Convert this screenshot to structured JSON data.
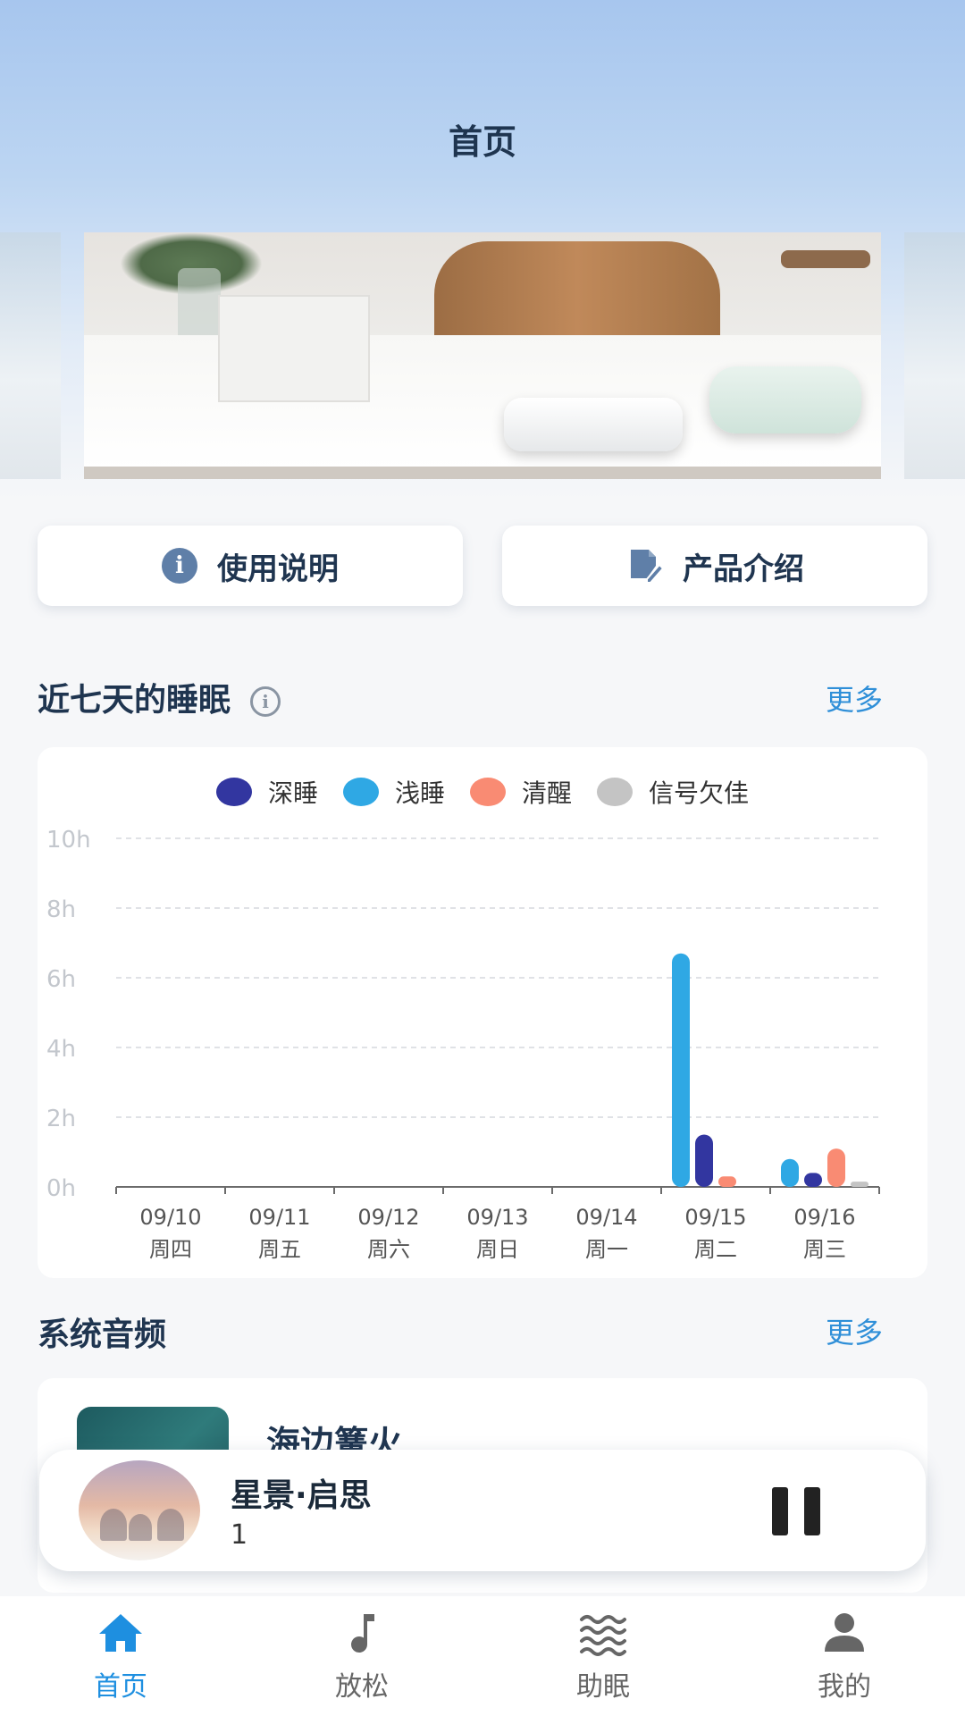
{
  "header": {
    "title": "首页"
  },
  "quick_actions": {
    "manual_label": "使用说明",
    "intro_label": "产品介绍"
  },
  "sleep_section": {
    "title": "近七天的睡眠",
    "more_label": "更多"
  },
  "chart_data": {
    "type": "bar",
    "title": "",
    "ylabel": "",
    "xlabel": "",
    "ylim": [
      0,
      10
    ],
    "yticks": [
      "0h",
      "2h",
      "4h",
      "6h",
      "8h",
      "10h"
    ],
    "categories": [
      "09/10",
      "09/11",
      "09/12",
      "09/13",
      "09/14",
      "09/15",
      "09/16"
    ],
    "weekdays": [
      "周四",
      "周五",
      "周六",
      "周日",
      "周一",
      "周二",
      "周三"
    ],
    "legend_placement": "top-center",
    "grid": true,
    "series": [
      {
        "name": "浅睡",
        "color": "#2fa8e4",
        "values": [
          0,
          0,
          0,
          0,
          0,
          6.7,
          0.8
        ]
      },
      {
        "name": "深睡",
        "color": "#3236a0",
        "values": [
          0,
          0,
          0,
          0,
          0,
          1.5,
          0.4
        ]
      },
      {
        "name": "清醒",
        "color": "#f98b73",
        "values": [
          0,
          0,
          0,
          0,
          0,
          0.3,
          1.1
        ]
      },
      {
        "name": "信号欠佳",
        "color": "#c4c4c4",
        "values": [
          0,
          0,
          0,
          0,
          0,
          0,
          0.15
        ]
      }
    ],
    "legend_order": [
      "深睡",
      "浅睡",
      "清醒",
      "信号欠佳"
    ]
  },
  "audio_section": {
    "title": "系统音频",
    "more_label": "更多",
    "first_item": "海边篝火"
  },
  "player": {
    "title": "星景·启思",
    "subtitle": "1"
  },
  "nav": {
    "items": [
      {
        "label": "首页",
        "icon": "home-icon",
        "active": true
      },
      {
        "label": "放松",
        "icon": "music-note-icon",
        "active": false
      },
      {
        "label": "助眠",
        "icon": "waves-icon",
        "active": false
      },
      {
        "label": "我的",
        "icon": "user-icon",
        "active": false
      }
    ]
  },
  "colors": {
    "accent": "#1e8fe0",
    "title_text": "#1f3550"
  }
}
